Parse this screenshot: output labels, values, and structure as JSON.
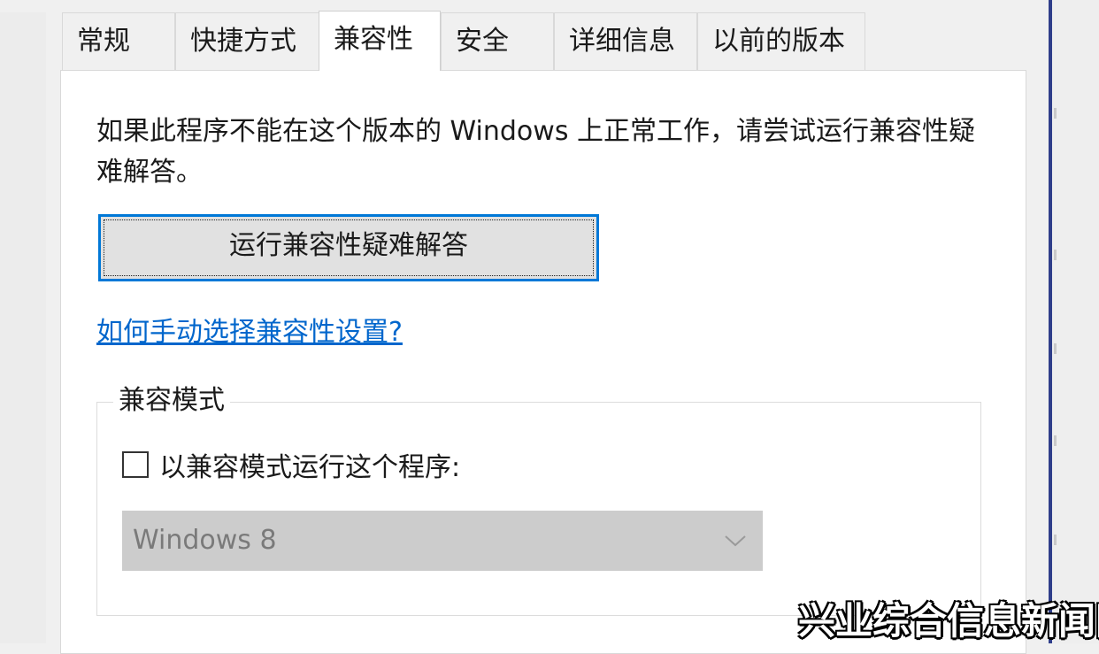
{
  "tabs": [
    {
      "label": "常规",
      "active": false
    },
    {
      "label": "快捷方式",
      "active": false
    },
    {
      "label": "兼容性",
      "active": true
    },
    {
      "label": "安全",
      "active": false
    },
    {
      "label": "详细信息",
      "active": false
    },
    {
      "label": "以前的版本",
      "active": false
    }
  ],
  "compatibility": {
    "description": "如果此程序不能在这个版本的 Windows 上正常工作，请尝试运行兼容性疑难解答。",
    "troubleshoot_button": "运行兼容性疑难解答",
    "help_link": "如何手动选择兼容性设置?",
    "mode_group_title": "兼容模式",
    "run_in_compat_label": "以兼容模式运行这个程序:",
    "run_in_compat_checked": false,
    "os_select_value": "Windows 8",
    "os_select_enabled": false
  },
  "watermark": "兴业综合信息新闻网",
  "colors": {
    "accent": "#0078d7",
    "link": "#0066cc",
    "disabled_select_bg": "#cccccc",
    "window_edge": "#2f3e8a"
  }
}
